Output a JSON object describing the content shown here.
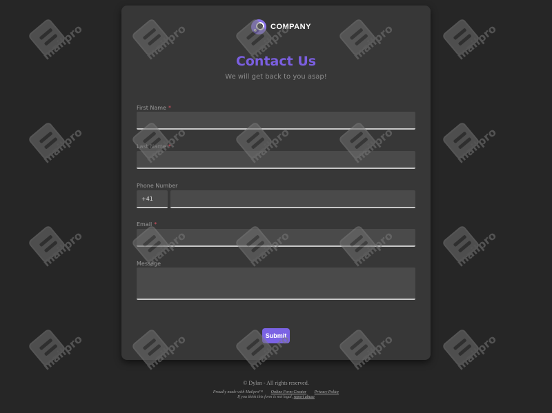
{
  "brand": {
    "name": "COMPANY",
    "accent_color": "#7b5fe0"
  },
  "header": {
    "title": "Contact Us",
    "subtitle": "We will get back to you asap!"
  },
  "form": {
    "first_name": {
      "label": "First Name",
      "required_mark": "*",
      "value": ""
    },
    "last_name": {
      "label": "Last Name",
      "required_mark": "*",
      "value": ""
    },
    "phone": {
      "label": "Phone Number",
      "country_code": "+41",
      "value": ""
    },
    "email": {
      "label": "Email",
      "required_mark": "*",
      "value": ""
    },
    "message": {
      "label": "Message",
      "value": ""
    },
    "submit_label": "Submit"
  },
  "watermark": {
    "text": "mailpro",
    "icon": "mailpro-logo-icon"
  },
  "footer": {
    "copyright": "© Dylan - All rights reserved.",
    "made_with": "Proudly made with Mailpro™",
    "links": [
      "Online Form Creator",
      "Privacy Policy"
    ],
    "legal_text": "If you think this form is not legal,",
    "report_link": "report abuse"
  }
}
